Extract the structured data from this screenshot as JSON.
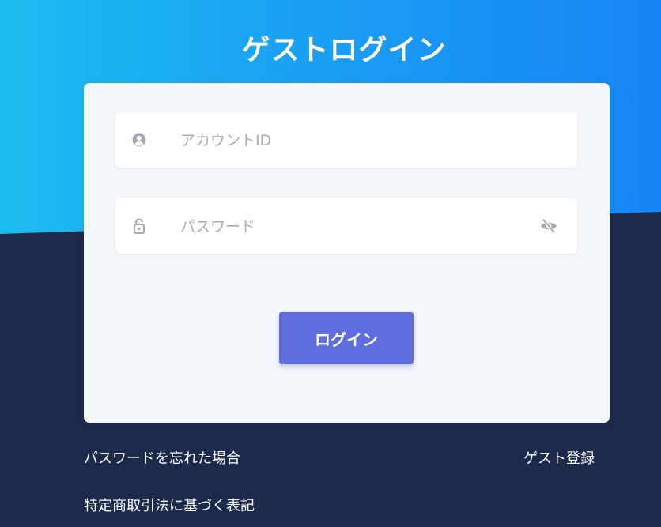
{
  "page": {
    "title": "ゲストログイン"
  },
  "form": {
    "account_placeholder": "アカウントID",
    "account_value": "",
    "password_placeholder": "パスワード",
    "password_value": "",
    "login_label": "ログイン"
  },
  "links": {
    "forgot_password": "パスワードを忘れた場合",
    "guest_register": "ゲスト登録",
    "commerce_law": "特定商取引法に基づく表記"
  },
  "icons": {
    "account": "user-circle-icon",
    "password": "lock-icon",
    "visibility": "eye-off-icon"
  },
  "colors": {
    "gradient_start": "#1bbdf0",
    "gradient_end": "#1785f5",
    "background_dark": "#1c2a4c",
    "card": "#f3f6fa",
    "button": "#5f6ddf"
  }
}
